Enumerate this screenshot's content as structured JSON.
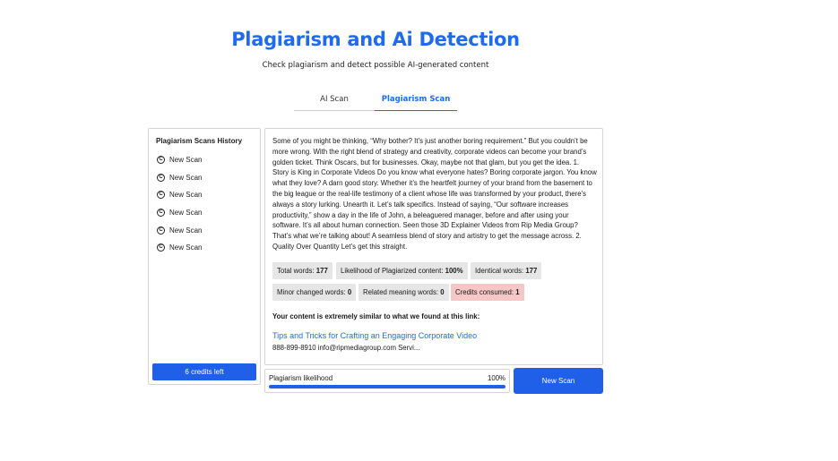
{
  "header": {
    "title": "Plagiarism and Ai Detection",
    "subtitle": "Check plagiarism and detect possible AI-generated content"
  },
  "tabs": [
    {
      "label": "AI Scan",
      "active": false
    },
    {
      "label": "Plagiarism Scan",
      "active": true
    }
  ],
  "sidebar": {
    "title": "Plagiarism Scans History",
    "items": [
      {
        "label": "New Scan",
        "icon": "copyright-icon"
      },
      {
        "label": "New Scan",
        "icon": "copyright-icon"
      },
      {
        "label": "New Scan",
        "icon": "copyright-icon"
      },
      {
        "label": "New Scan",
        "icon": "copyright-icon"
      },
      {
        "label": "New Scan",
        "icon": "copyright-icon"
      },
      {
        "label": "New Scan",
        "icon": "copyright-icon"
      }
    ],
    "credits_label": "6 credits left"
  },
  "main": {
    "body_text": "Some of you might be thinking, “Why bother? It’s just another boring requirement.” But you couldn’t be more wrong. With the right blend of strategy and creativity, corporate videos can become your brand’s golden ticket. Think Oscars, but for businesses. Okay, maybe not that glam, but you get the idea. 1. Story is King in Corporate Videos Do you know what everyone hates? Boring corporate jargon. You know what they love? A darn good story. Whether it’s the heartfelt journey of your brand from the basement to the big league or the real-life testimony of a client whose life was transformed by your product, there’s always a story lurking. Unearth it. Let’s talk specifics. Instead of saying, “Our software increases productivity,” show a day in the life of John, a beleaguered manager, before and after using your software. It’s all about human connection. Seen those 3D Explainer Videos from Rip Media Group? That’s what we’re talking about! A seamless blend of story and artistry to get the message across. 2. Quality Over Quantity Let’s get this straight.",
    "stats": {
      "total_words_label": "Total words:",
      "total_words": "177",
      "likelihood_label": "Likelihood of Plagiarized content:",
      "likelihood_value": "100%",
      "identical_label": "Identical words:",
      "identical_value": "177",
      "minor_label": "Minor changed words:",
      "minor_value": "0",
      "related_label": "Related meaning words:",
      "related_value": "0",
      "credits_label": "Credits consumed:",
      "credits_value": "1"
    },
    "similar_heading": "Your content is extremely similar to what we found at this link:",
    "source": {
      "title": "Tips and Tricks for Crafting an Engaging Corporate Video",
      "snippet": "888-899-8910 info@ripmediagroup.com Servi..."
    }
  },
  "likelihood": {
    "label": "Plagiarism likelihood",
    "percent_text": "100%",
    "progress": 1.0
  },
  "actions": {
    "new_scan_label": "New Scan"
  },
  "colors": {
    "accent": "#1e6bf0",
    "button": "#2060e8",
    "chip": "#e6e6e6",
    "chip_alert": "#f7c7c7"
  }
}
